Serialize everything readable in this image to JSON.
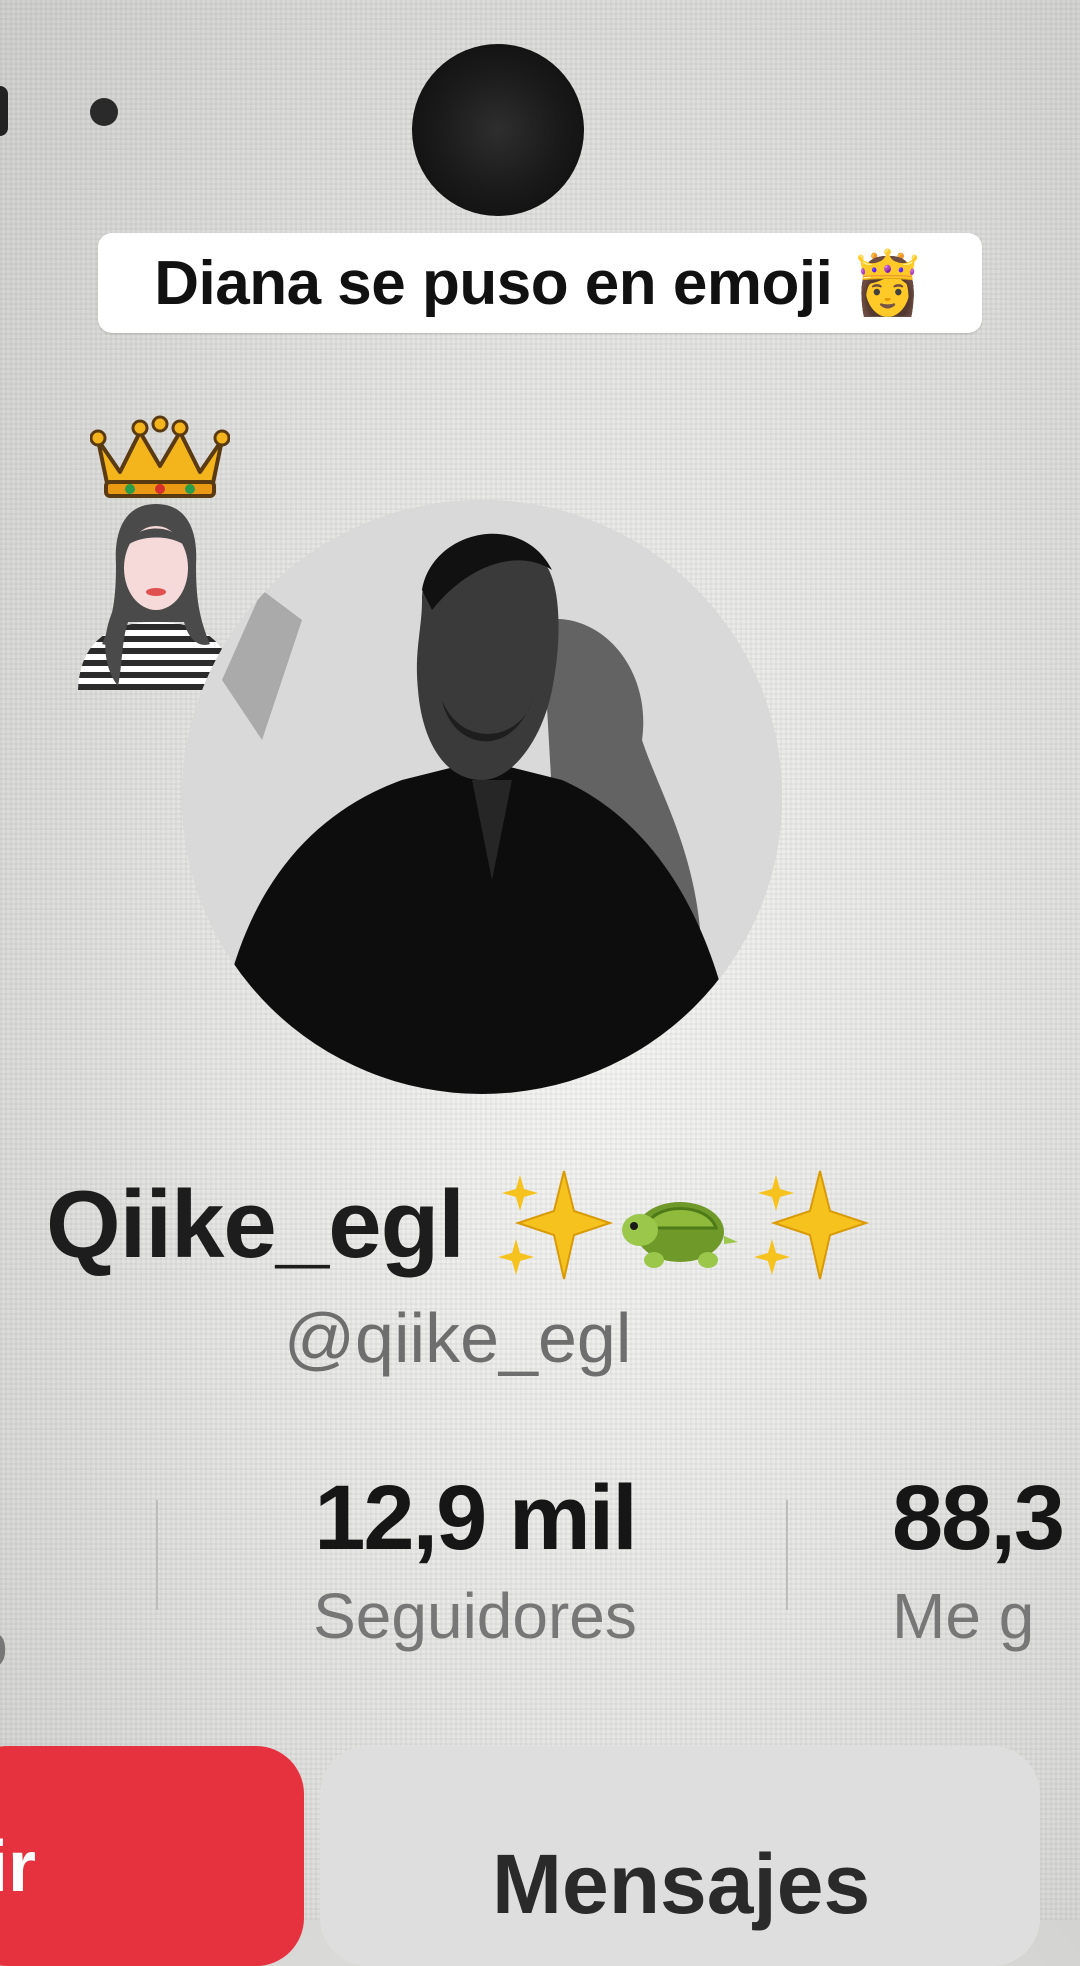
{
  "caption": {
    "text": "Diana se puso en  emoji 👸"
  },
  "profile": {
    "display_name": "Qiike_egl",
    "emojis": [
      "sparkles",
      "turtle",
      "sparkles"
    ],
    "username": "@qiike_egl"
  },
  "stats": [
    {
      "value": "12,9 mil",
      "label": "Seguidores"
    },
    {
      "value": "88,3",
      "label": "Me g"
    }
  ],
  "stats_left_fragment": "o",
  "buttons": {
    "follow_label": "ir",
    "messages_label": "Mensajes"
  },
  "colors": {
    "follow": "#e5323e",
    "messages": "#dedede",
    "caption_bg": "#ffffff"
  },
  "icons": [
    "crown-icon",
    "woman-sticker-icon",
    "sparkles-icon",
    "turtle-icon"
  ]
}
